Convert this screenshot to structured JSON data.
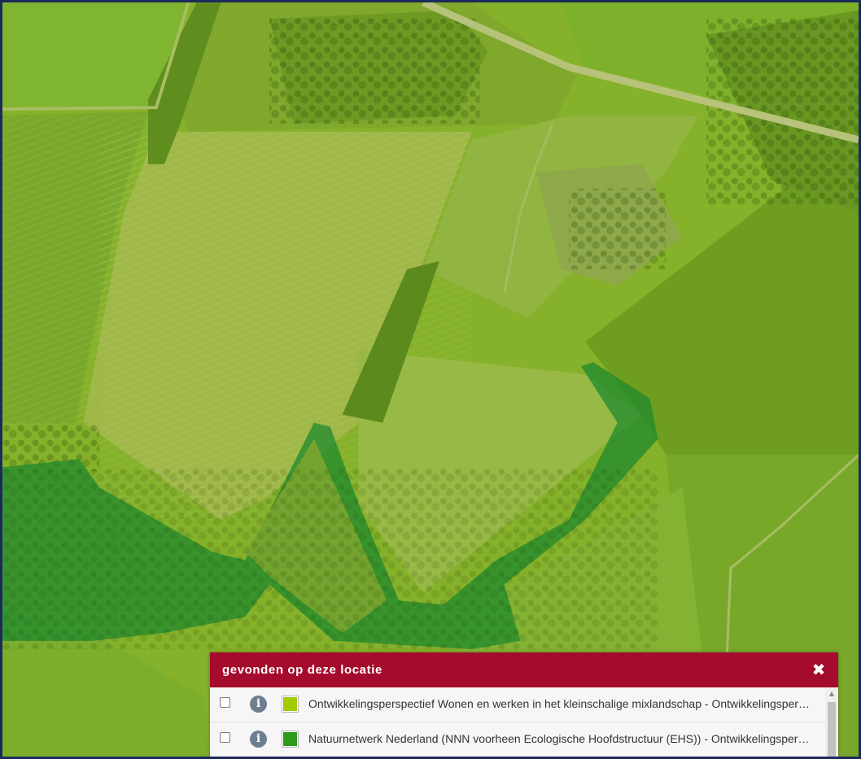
{
  "map": {
    "layers": [
      {
        "name": "Ontwikkelingsperspectief Wonen en werken in het kleinschalige mixlandschap",
        "color": "#a3cc00"
      },
      {
        "name": "Natuurnetwerk Nederland",
        "color": "#2e9a1a"
      }
    ]
  },
  "popup": {
    "title": "gevonden op deze locatie",
    "close_icon": "close-icon",
    "colors": {
      "header": "#a50b2c"
    },
    "results": [
      {
        "label": "Ontwikkelingsperspectief Wonen en werken in het kleinschalige mixlandschap - Ontwikkelingsperspectief",
        "swatch_color": "#a3cc00",
        "checked": false,
        "icon": "info-icon"
      },
      {
        "label": "Natuurnetwerk Nederland (NNN voorheen Ecologische Hoofdstructuur (EHS)) - Ontwikkelingsperspectief",
        "swatch_color": "#2e9a1a",
        "checked": false,
        "icon": "info-icon"
      }
    ]
  }
}
